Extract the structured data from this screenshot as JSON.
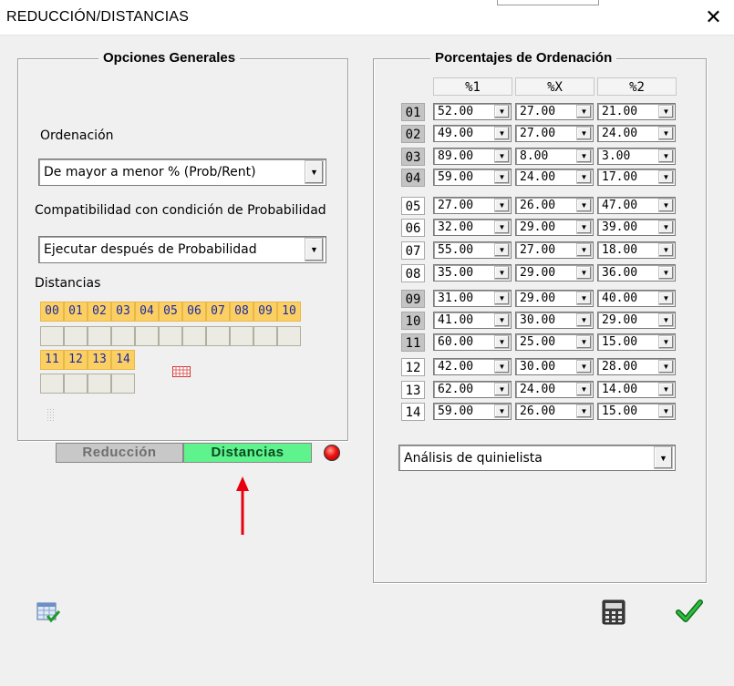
{
  "window": {
    "title": "REDUCCIÓN/DISTANCIAS",
    "close_symbol": "✕"
  },
  "general": {
    "legend": "Opciones Generales",
    "ordenacion_label": "Ordenación",
    "ordenacion_value": "De mayor a menor % (Prob/Rent)",
    "compat_label": "Compatibilidad con condición de Probabilidad",
    "compat_value": "Ejecutar después de Probabilidad",
    "distancias_label": "Distancias",
    "distance_row1": [
      "00",
      "01",
      "02",
      "03",
      "04",
      "05",
      "06",
      "07",
      "08",
      "09",
      "10"
    ],
    "distance_row2": [
      "11",
      "12",
      "13",
      "14"
    ]
  },
  "mode_toggle": {
    "reduccion": "Reducción",
    "distancias": "Distancias",
    "active": "Distancias"
  },
  "percentages": {
    "legend": "Porcentajes de Ordenación",
    "columns": [
      "%1",
      "%X",
      "%2"
    ],
    "rows": [
      {
        "n": "01",
        "v": [
          "52.00",
          "27.00",
          "21.00"
        ],
        "style": "gray"
      },
      {
        "n": "02",
        "v": [
          "49.00",
          "27.00",
          "24.00"
        ],
        "style": "gray"
      },
      {
        "n": "03",
        "v": [
          "89.00",
          "8.00",
          "3.00"
        ],
        "style": "gray"
      },
      {
        "n": "04",
        "v": [
          "59.00",
          "24.00",
          "17.00"
        ],
        "style": "gray"
      },
      {
        "n": "05",
        "v": [
          "27.00",
          "26.00",
          "47.00"
        ],
        "style": "white"
      },
      {
        "n": "06",
        "v": [
          "32.00",
          "29.00",
          "39.00"
        ],
        "style": "white"
      },
      {
        "n": "07",
        "v": [
          "55.00",
          "27.00",
          "18.00"
        ],
        "style": "white"
      },
      {
        "n": "08",
        "v": [
          "35.00",
          "29.00",
          "36.00"
        ],
        "style": "white"
      },
      {
        "n": "09",
        "v": [
          "31.00",
          "29.00",
          "40.00"
        ],
        "style": "gray"
      },
      {
        "n": "10",
        "v": [
          "41.00",
          "30.00",
          "29.00"
        ],
        "style": "gray"
      },
      {
        "n": "11",
        "v": [
          "60.00",
          "25.00",
          "15.00"
        ],
        "style": "gray"
      },
      {
        "n": "12",
        "v": [
          "42.00",
          "30.00",
          "28.00"
        ],
        "style": "white"
      },
      {
        "n": "13",
        "v": [
          "62.00",
          "24.00",
          "14.00"
        ],
        "style": "white"
      },
      {
        "n": "14",
        "v": [
          "59.00",
          "26.00",
          "15.00"
        ],
        "style": "white"
      }
    ],
    "analysis_value": "Análisis de quinielista"
  },
  "footer": {
    "left_icon": "table-edit-icon",
    "calculator_icon": "calculator-icon",
    "ok_icon": "checkmark-icon"
  },
  "colors": {
    "highlight": "#fccf63",
    "active_tab": "#5ef38c",
    "arrow": "#e8000f"
  }
}
